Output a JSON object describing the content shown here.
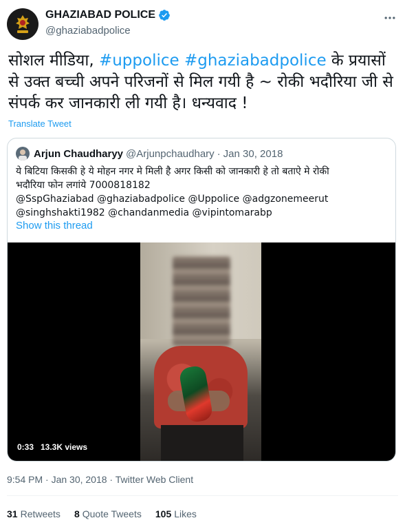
{
  "tweet": {
    "author_name": "GHAZIABAD POLICE",
    "author_handle": "@ghaziabadpolice",
    "text_seg1": "सोशल मीडिया, ",
    "hashtag1": "#uppolice",
    "text_seg2": " ",
    "hashtag2": "#ghaziabadpolice",
    "text_seg3": " के प्रयासों से उक्त बच्ची अपने परिजनों से मिल गयी है ~ रोकी भदौरिया जी से संपर्क कर जानकारी ली गयी है। धन्यवाद !",
    "translate_label": "Translate Tweet",
    "timestamp": "9:54 PM · Jan 30, 2018",
    "source": "Twitter Web Client",
    "meta_separator": " · "
  },
  "quoted": {
    "author_name": "Arjun Chaudharyy",
    "author_handle": "@Arjunpchaudhary",
    "separator": "·",
    "date": "Jan 30, 2018",
    "text_line1": "ये बिटिया किसकी हे ये मोहन नगर मे मिली है अगर किसी को जानकारी हे तो बताऐ मे रोकी",
    "text_line2": "भदौरिया फोन लगांये  7000818182",
    "text_line3": "@SspGhaziabad @ghaziabadpolice @Uppolice @adgzonemeerut",
    "text_line4": "@singhshakti1982 @chandanmedia  @vipintomarabp",
    "show_thread": "Show this thread",
    "video_time": "0:33",
    "video_views": "13.3K views"
  },
  "stats": {
    "retweets_count": "31",
    "retweets_label": "Retweets",
    "quotes_count": "8",
    "quotes_label": "Quote Tweets",
    "likes_count": "105",
    "likes_label": "Likes"
  },
  "icons": {
    "verified": "verified-badge-icon",
    "more": "more-icon",
    "avatar": "police-emblem-icon"
  },
  "colors": {
    "accent": "#1d9bf0",
    "text": "#0f1419",
    "secondary": "#536471",
    "border": "#cfd9de"
  }
}
